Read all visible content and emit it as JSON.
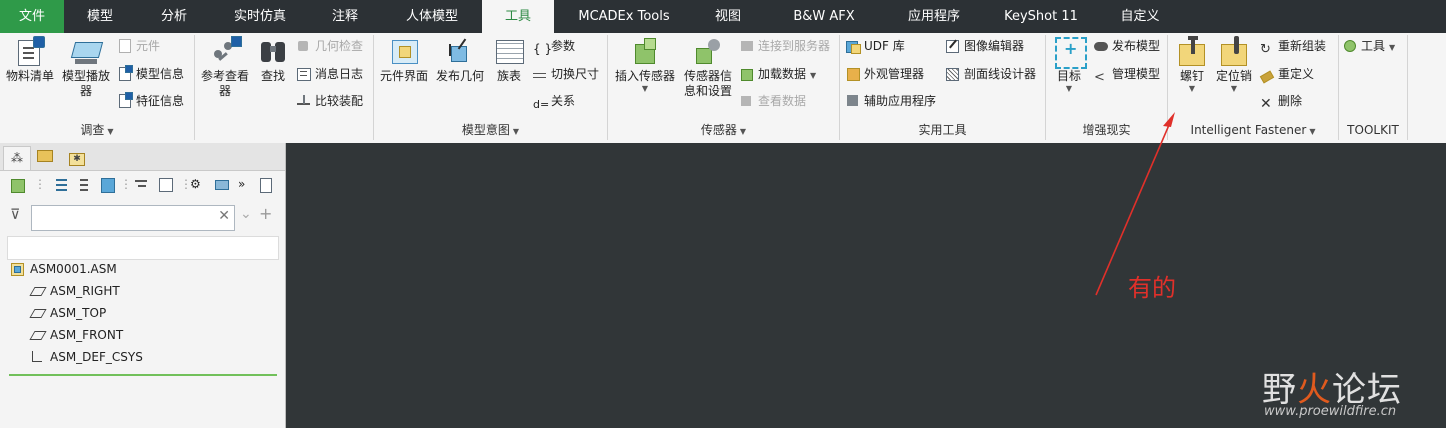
{
  "tabs": [
    {
      "label": "文件"
    },
    {
      "label": "模型"
    },
    {
      "label": "分析"
    },
    {
      "label": "实时仿真"
    },
    {
      "label": "注释"
    },
    {
      "label": "人体模型"
    },
    {
      "label": "工具"
    },
    {
      "label": "MCADEx Tools"
    },
    {
      "label": "视图"
    },
    {
      "label": "B&W AFX"
    },
    {
      "label": "应用程序"
    },
    {
      "label": "KeyShot 11"
    },
    {
      "label": "自定义"
    }
  ],
  "ribbon": {
    "survey": {
      "label": "调查",
      "bom": "物料清单",
      "model_player": "模型播放\n器",
      "component": "元件",
      "model_info": "模型信息",
      "feature_info": "特征信息"
    },
    "model_intent": {
      "label": "模型意图",
      "ref_viewer": "参考查看\n器",
      "find": "查找",
      "geom_check": "几何检查",
      "message_log": "消息日志",
      "compare_asm": "比较装配",
      "comp_interface": "元件界面",
      "publish_geom": "发布几何",
      "family_table": "族表",
      "params": "参数",
      "switch_dims": "切换尺寸",
      "relations": "关系",
      "relations_prefix": "d="
    },
    "sensor": {
      "label": "传感器",
      "insert_sensor": "插入传感器",
      "sensor_info": "传感器信\n息和设置",
      "connect_server": "连接到服务器",
      "load_data": "加载数据",
      "view_data": "查看数据"
    },
    "utilities": {
      "label": "实用工具",
      "udf": "UDF 库",
      "appearance_mgr": "外观管理器",
      "aux_app": "辅助应用程序",
      "image_editor": "图像编辑器",
      "xsection_designer": "剖面线设计器"
    },
    "ar": {
      "label": "增强现实",
      "target": "目标",
      "publish_model": "发布模型",
      "manage_model": "管理模型"
    },
    "fastener": {
      "label": "Intelligent Fastener",
      "screw": "螺钉",
      "pin": "定位销",
      "reassemble": "重新组装",
      "redefine": "重定义",
      "delete": "删除"
    },
    "toolkit": {
      "label": "TOOLKIT",
      "tools": "工具"
    }
  },
  "model_tree": {
    "filter_placeholder": "",
    "items": [
      {
        "label": "ASM0001.ASM",
        "icon": "assembly-icon"
      },
      {
        "label": "ASM_RIGHT",
        "icon": "datum-plane-icon"
      },
      {
        "label": "ASM_TOP",
        "icon": "datum-plane-icon"
      },
      {
        "label": "ASM_FRONT",
        "icon": "datum-plane-icon"
      },
      {
        "label": "ASM_DEF_CSYS",
        "icon": "csys-icon"
      }
    ]
  },
  "annotation": {
    "text": "有的",
    "color": "#e0302a"
  },
  "watermark": {
    "brand_a": "野",
    "brand_b": "火",
    "brand_c": "论坛",
    "url": "www.proewildfire.cn"
  },
  "colors": {
    "file_tab": "#2f9a49",
    "active_tab_text": "#2f8a45",
    "canvas": "#313638",
    "tabbar": "#2c3135"
  }
}
